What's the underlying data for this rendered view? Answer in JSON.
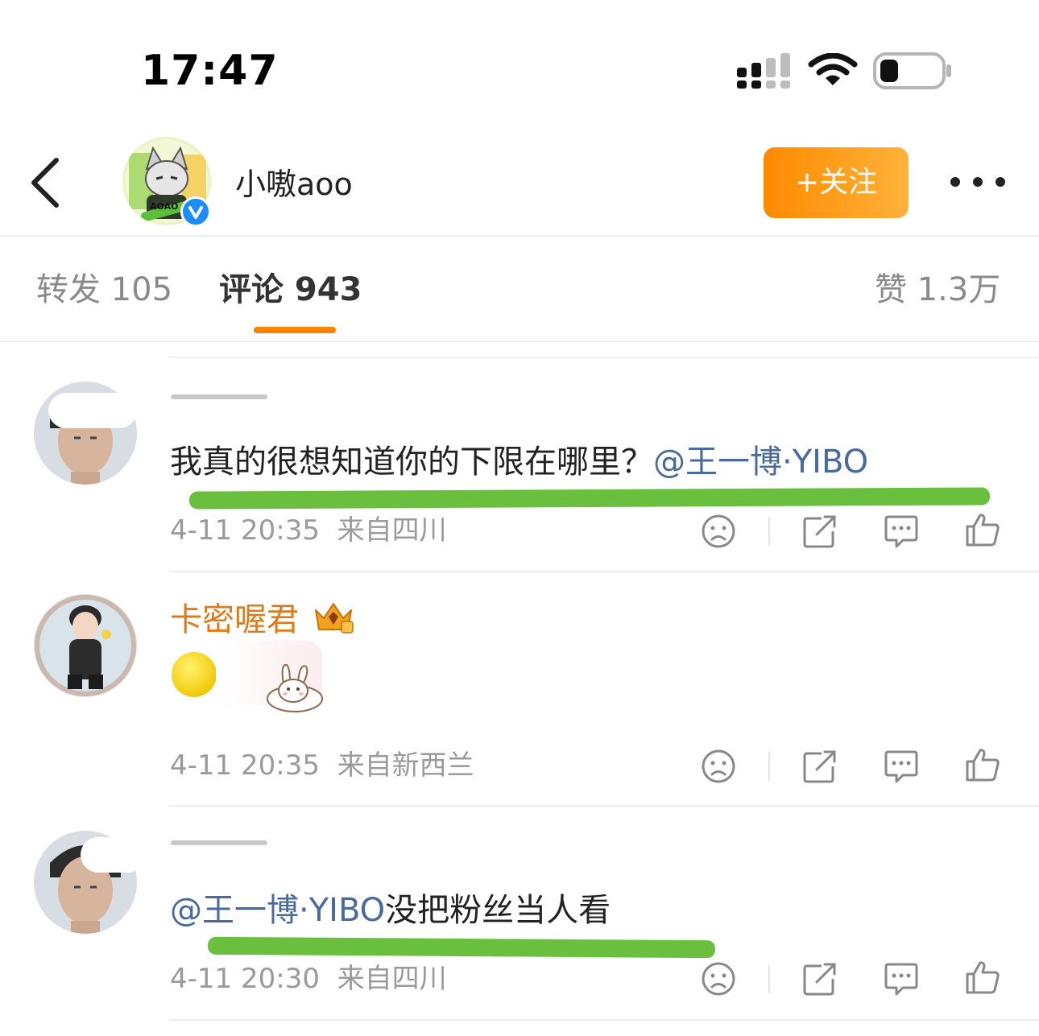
{
  "status_bar": {
    "time": "17:47"
  },
  "header": {
    "username": "小嗷aoo",
    "follow_label": "+关注",
    "avatar_badge": "AOAO"
  },
  "tabs": {
    "repost": "转发 105",
    "comment": "评论 943",
    "like": "赞 1.3万"
  },
  "comments": [
    {
      "text": "我真的很想知道你的下限在哪里？",
      "mention": "@王一博·YIBO",
      "time": "4-11 20:35",
      "location": "来自四川"
    },
    {
      "username": "卡密喔君",
      "time": "4-11 20:35",
      "location": "来自新西兰"
    },
    {
      "mention": "@王一博·YIBO",
      "text": "没把粉丝当人看",
      "time": "4-11 20:30",
      "location": "来自四川"
    }
  ],
  "icons": [
    "sad-face-icon",
    "share-icon",
    "comment-icon",
    "thumbs-up-icon"
  ],
  "colors": {
    "accent": "#ff8200",
    "mention": "#4a6a9e",
    "highlight": "#6bbf3f",
    "verified": "#1a8cff"
  }
}
